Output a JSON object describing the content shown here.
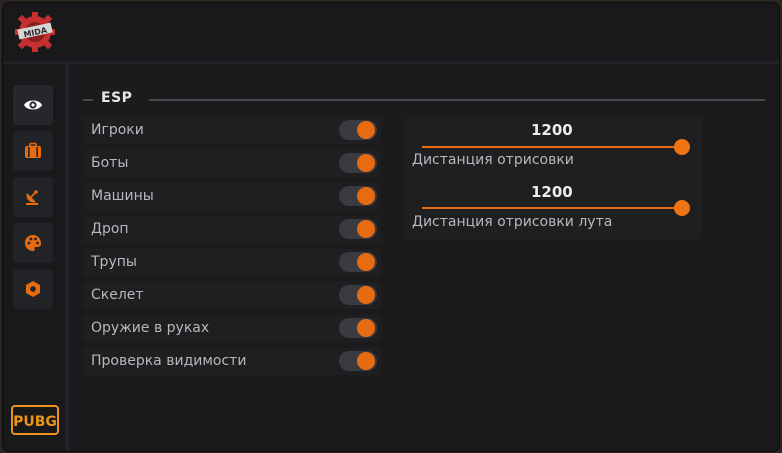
{
  "app": {
    "logo_text": "MIDA"
  },
  "sidebar": {
    "items": [
      {
        "icon": "eye-icon",
        "active": true
      },
      {
        "icon": "briefcase-icon",
        "active": false
      },
      {
        "icon": "satellite-dish-icon",
        "active": false
      },
      {
        "icon": "palette-icon",
        "active": false
      },
      {
        "icon": "hexagon-icon",
        "active": false
      }
    ],
    "game_logo_text": "PUBG"
  },
  "section": {
    "title": "ESP"
  },
  "toggles": [
    {
      "label": "Игроки",
      "on": true
    },
    {
      "label": "Боты",
      "on": true
    },
    {
      "label": "Машины",
      "on": true
    },
    {
      "label": "Дроп",
      "on": true
    },
    {
      "label": "Трупы",
      "on": true
    },
    {
      "label": "Скелет",
      "on": true
    },
    {
      "label": "Оружие в руках",
      "on": true
    },
    {
      "label": "Проверка видимости",
      "on": true
    }
  ],
  "sliders": [
    {
      "value": "1200",
      "label": "Дистанция отрисовки",
      "fill_fraction": 1.0
    },
    {
      "value": "1200",
      "label": "Дистанция отрисовки лута",
      "fill_fraction": 1.0
    }
  ],
  "colors": {
    "accent": "#e76b10",
    "background": "#19191b",
    "panel": "#1f1f22",
    "toggle_track": "#3a3b40",
    "text": "#b8b8bc"
  }
}
